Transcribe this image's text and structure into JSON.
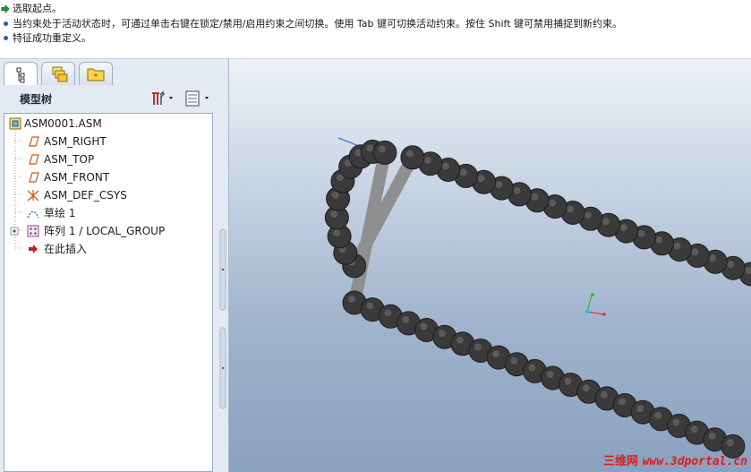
{
  "messages": [
    {
      "icon": "arrow-right-icon",
      "text": "选取起点。"
    },
    {
      "icon": "bullet-icon",
      "text": "当约束处于活动状态时，可通过单击右键在锁定/禁用/启用约束之间切换。使用 Tab 键可切换活动约束。按住 Shift 键可禁用捕捉到新约束。"
    },
    {
      "icon": "bullet-icon",
      "text": "特征成功重定义。"
    }
  ],
  "left_panel": {
    "tabs": [
      "model-tree-tab",
      "layers-tab",
      "favorites-tab"
    ],
    "title": "模型树",
    "tree": [
      {
        "label": "ASM0001.ASM",
        "icon": "assembly-icon"
      },
      {
        "label": "ASM_RIGHT",
        "icon": "datum-plane-icon"
      },
      {
        "label": "ASM_TOP",
        "icon": "datum-plane-icon"
      },
      {
        "label": "ASM_FRONT",
        "icon": "datum-plane-icon"
      },
      {
        "label": "ASM_DEF_CSYS",
        "icon": "csys-icon"
      },
      {
        "label": "草绘 1",
        "icon": "sketch-icon"
      },
      {
        "label": "阵列 1 / LOCAL_GROUP",
        "icon": "pattern-icon"
      },
      {
        "label": "在此插入",
        "icon": "insert-here-arrow-icon"
      }
    ]
  },
  "viewport": {
    "content": "roller-chain-assembly",
    "watermark_cn": "三维网",
    "watermark_url": "www.3dportal.cn"
  },
  "colors": {
    "accent": "#1f5fbf",
    "viewport_top": "#eef2f7",
    "viewport_bottom": "#8aa1bf",
    "roller": "#3a3a3a",
    "link_plate": "#8f8f8f",
    "watermark": "#e01b1b"
  }
}
